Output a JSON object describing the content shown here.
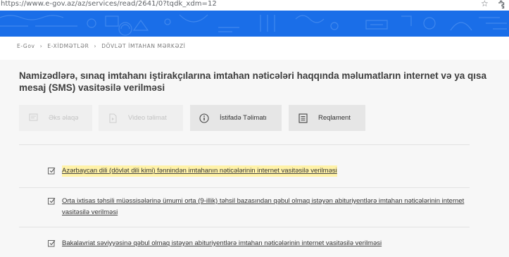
{
  "browser": {
    "url": "https://www.e-gov.az/az/services/read/2641/0?tqdk_xdm=12"
  },
  "breadcrumb": [
    "E-Gov",
    "E-XİDMƏTLƏR",
    "DÖVLƏT İMTAHAN MƏRKƏZİ"
  ],
  "page": {
    "title": "Namizədlərə, sınaq imtahanı iştirakçılarına imtahan nəticələri haqqında məlumatların internet və ya qısa mesaj (SMS) vasitəsilə verilməsi"
  },
  "actions": [
    {
      "label": "Əks əlaqə",
      "icon": "feedback-icon",
      "enabled": false
    },
    {
      "label": "Video təlimat",
      "icon": "video-icon",
      "enabled": false
    },
    {
      "label": "İstifadə Təlimatı",
      "icon": "info-icon",
      "enabled": true
    },
    {
      "label": "Reqlament",
      "icon": "document-icon",
      "enabled": true
    }
  ],
  "services": [
    {
      "label": "Azərbaycan dili (dövlət dili kimi) fənnindən imtahanın nəticələrinin internet vasitəsilə verilməsi",
      "highlighted": true
    },
    {
      "label": "Orta ixtisas təhsili müəssisələrinə ümumi orta (9-illik) təhsil bazasından qəbul olmaq istəyən abituriyentlərə imtahan nəticələrinin internet vasitəsilə verilməsi",
      "highlighted": false
    },
    {
      "label": "Bakalavriat səviyyəsinə qəbul olmaq istəyən abituriyentlərə imtahan nəticələrinin internet vasitəsilə verilməsi",
      "highlighted": false
    }
  ],
  "colors": {
    "banner": "#1a6ee8",
    "panel": "#f7f7f7",
    "highlight": "#fff2a8"
  }
}
